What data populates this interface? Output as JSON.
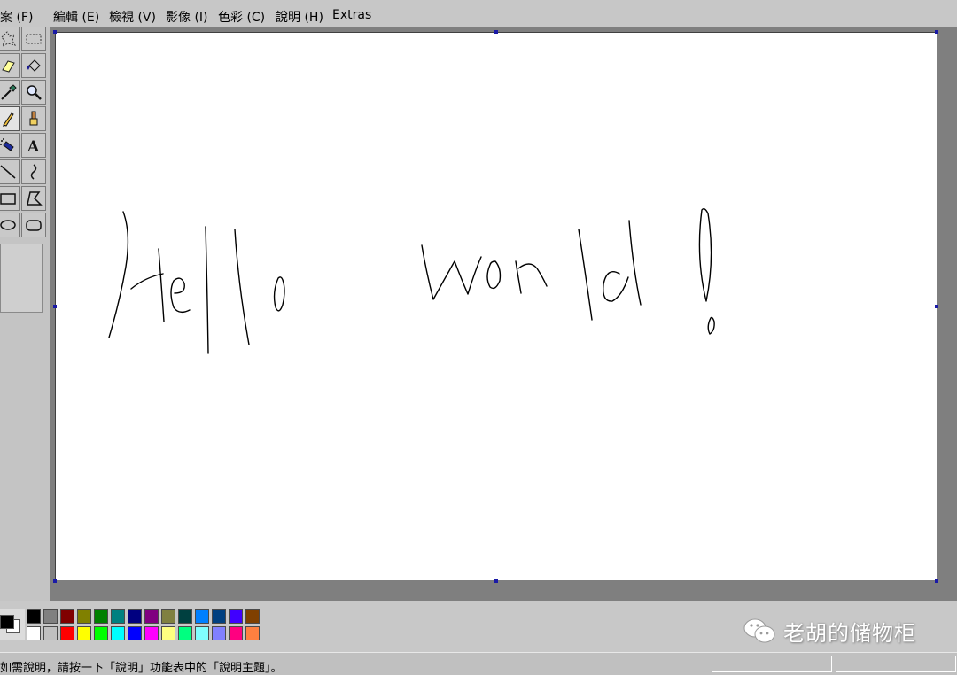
{
  "menubar": {
    "items": [
      {
        "label": "檔案 (F)"
      },
      {
        "label": "編輯 (E)"
      },
      {
        "label": "檢視 (V)"
      },
      {
        "label": "影像 (I)"
      },
      {
        "label": "色彩 (C)"
      },
      {
        "label": "說明 (H)"
      },
      {
        "label": "Extras"
      }
    ]
  },
  "toolbox": {
    "tools": [
      {
        "icon": "free-form-select-icon"
      },
      {
        "icon": "rect-select-icon"
      },
      {
        "icon": "eraser-icon"
      },
      {
        "icon": "fill-bucket-icon"
      },
      {
        "icon": "color-picker-icon"
      },
      {
        "icon": "magnifier-icon"
      },
      {
        "icon": "pencil-icon",
        "active": true
      },
      {
        "icon": "brush-icon"
      },
      {
        "icon": "airbrush-icon"
      },
      {
        "icon": "text-icon",
        "glyph": "A"
      },
      {
        "icon": "line-icon"
      },
      {
        "icon": "curve-icon"
      },
      {
        "icon": "rectangle-icon"
      },
      {
        "icon": "polygon-icon"
      },
      {
        "icon": "ellipse-icon"
      },
      {
        "icon": "rounded-rectangle-icon"
      }
    ]
  },
  "canvas": {
    "drawing": "Hello world!",
    "stroke_color": "#000000"
  },
  "palette": {
    "foreground": "#000000",
    "background": "#ffffff",
    "colors_top": [
      "#000000",
      "#808080",
      "#800000",
      "#808000",
      "#008000",
      "#008080",
      "#000080",
      "#800080",
      "#808040",
      "#004040",
      "#0080ff",
      "#004080",
      "#4000ff",
      "#804000"
    ],
    "colors_bottom": [
      "#ffffff",
      "#c0c0c0",
      "#ff0000",
      "#ffff00",
      "#00ff00",
      "#00ffff",
      "#0000ff",
      "#ff00ff",
      "#ffff80",
      "#00ff80",
      "#80ffff",
      "#8080ff",
      "#ff0080",
      "#ff8040"
    ]
  },
  "watermark": {
    "text": "老胡的储物柜",
    "icon": "wechat-icon"
  },
  "statusbar": {
    "help_text": "如需說明，請按一下「說明」功能表中的「說明主題」。"
  }
}
